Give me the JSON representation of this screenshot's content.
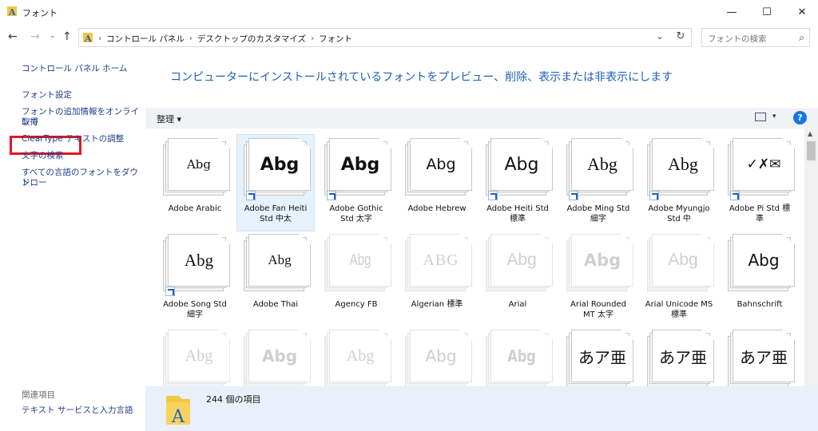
{
  "window": {
    "title": "フォント",
    "minimize_glyph": "—",
    "maximize_glyph": "☐",
    "close_glyph": "✕"
  },
  "nav": {
    "back_glyph": "←",
    "forward_glyph": "→",
    "recent_glyph": "⌄",
    "up_glyph": "↑",
    "breadcrumb_sep": "›",
    "breadcrumbs": [
      "コントロール パネル",
      "デスクトップのカスタマイズ",
      "フォント"
    ],
    "dropdown_glyph": "⌄",
    "refresh_glyph": "↻",
    "search_placeholder": "フォントの検索",
    "search_glyph": "⌕"
  },
  "sidebar": {
    "home": "コントロール パネル ホーム",
    "font_settings": "フォント設定",
    "get_more_line1": "フォントの追加情報をオンラインで",
    "get_more_line2": "取得",
    "cleartype": "ClearType テキストの調整",
    "find_char": "文字の検索",
    "download_line1": "すべての言語のフォントをダウンロー",
    "download_line2": "ド",
    "related_heading": "関連項目",
    "text_services": "テキスト サービスと入力言語"
  },
  "main": {
    "heading": "コンピューターにインストールされているフォントをプレビュー、削除、表示または非表示にします",
    "organize": "整理 ▾",
    "view_drop_glyph": "▾",
    "help_glyph": "?"
  },
  "fonts": [
    {
      "sample": "Abg",
      "line1": "Adobe Arabic",
      "line2": ""
    },
    {
      "sample": "Abg",
      "line1": "Adobe Fan Heiti",
      "line2": "Std 中太"
    },
    {
      "sample": "Abg",
      "line1": "Adobe Gothic",
      "line2": "Std 太字"
    },
    {
      "sample": "Abg",
      "line1": "Adobe Hebrew",
      "line2": ""
    },
    {
      "sample": "Abg",
      "line1": "Adobe Heiti Std",
      "line2": "標準"
    },
    {
      "sample": "Abg",
      "line1": "Adobe Ming Std",
      "line2": "細字"
    },
    {
      "sample": "Abg",
      "line1": "Adobe Myungjo",
      "line2": "Std 中"
    },
    {
      "sample": "✓✗✉",
      "line1": "Adobe Pi Std 標",
      "line2": "準"
    },
    {
      "sample": "Abg",
      "line1": "Adobe Song Std",
      "line2": "細字"
    },
    {
      "sample": "Abg",
      "line1": "Adobe Thai",
      "line2": ""
    },
    {
      "sample": "Abg",
      "line1": "Agency FB",
      "line2": ""
    },
    {
      "sample": "ABG",
      "line1": "Algerian 標準",
      "line2": ""
    },
    {
      "sample": "Abg",
      "line1": "Arial",
      "line2": ""
    },
    {
      "sample": "Abg",
      "line1": "Arial Rounded",
      "line2": "MT 太字"
    },
    {
      "sample": "Abg",
      "line1": "Arial Unicode MS",
      "line2": "標準"
    },
    {
      "sample": "Abg",
      "line1": "Bahnschrift",
      "line2": ""
    },
    {
      "sample": "Abg",
      "line1": "",
      "line2": ""
    },
    {
      "sample": "Abg",
      "line1": "",
      "line2": ""
    },
    {
      "sample": "Abg",
      "line1": "",
      "line2": ""
    },
    {
      "sample": "Abg",
      "line1": "",
      "line2": ""
    },
    {
      "sample": "Abg",
      "line1": "",
      "line2": ""
    },
    {
      "sample": "あア亜",
      "line1": "",
      "line2": ""
    },
    {
      "sample": "あア亜",
      "line1": "",
      "line2": ""
    },
    {
      "sample": "あア亜",
      "line1": "",
      "line2": ""
    }
  ],
  "status": {
    "item_count": "244 個の項目"
  },
  "colors": {
    "heading": "#1e5fb3",
    "link": "#1f3b8a",
    "highlight_box": "#e0181f",
    "selected_tile": "#e5f1fb",
    "statusbar": "#e9f0fa"
  }
}
